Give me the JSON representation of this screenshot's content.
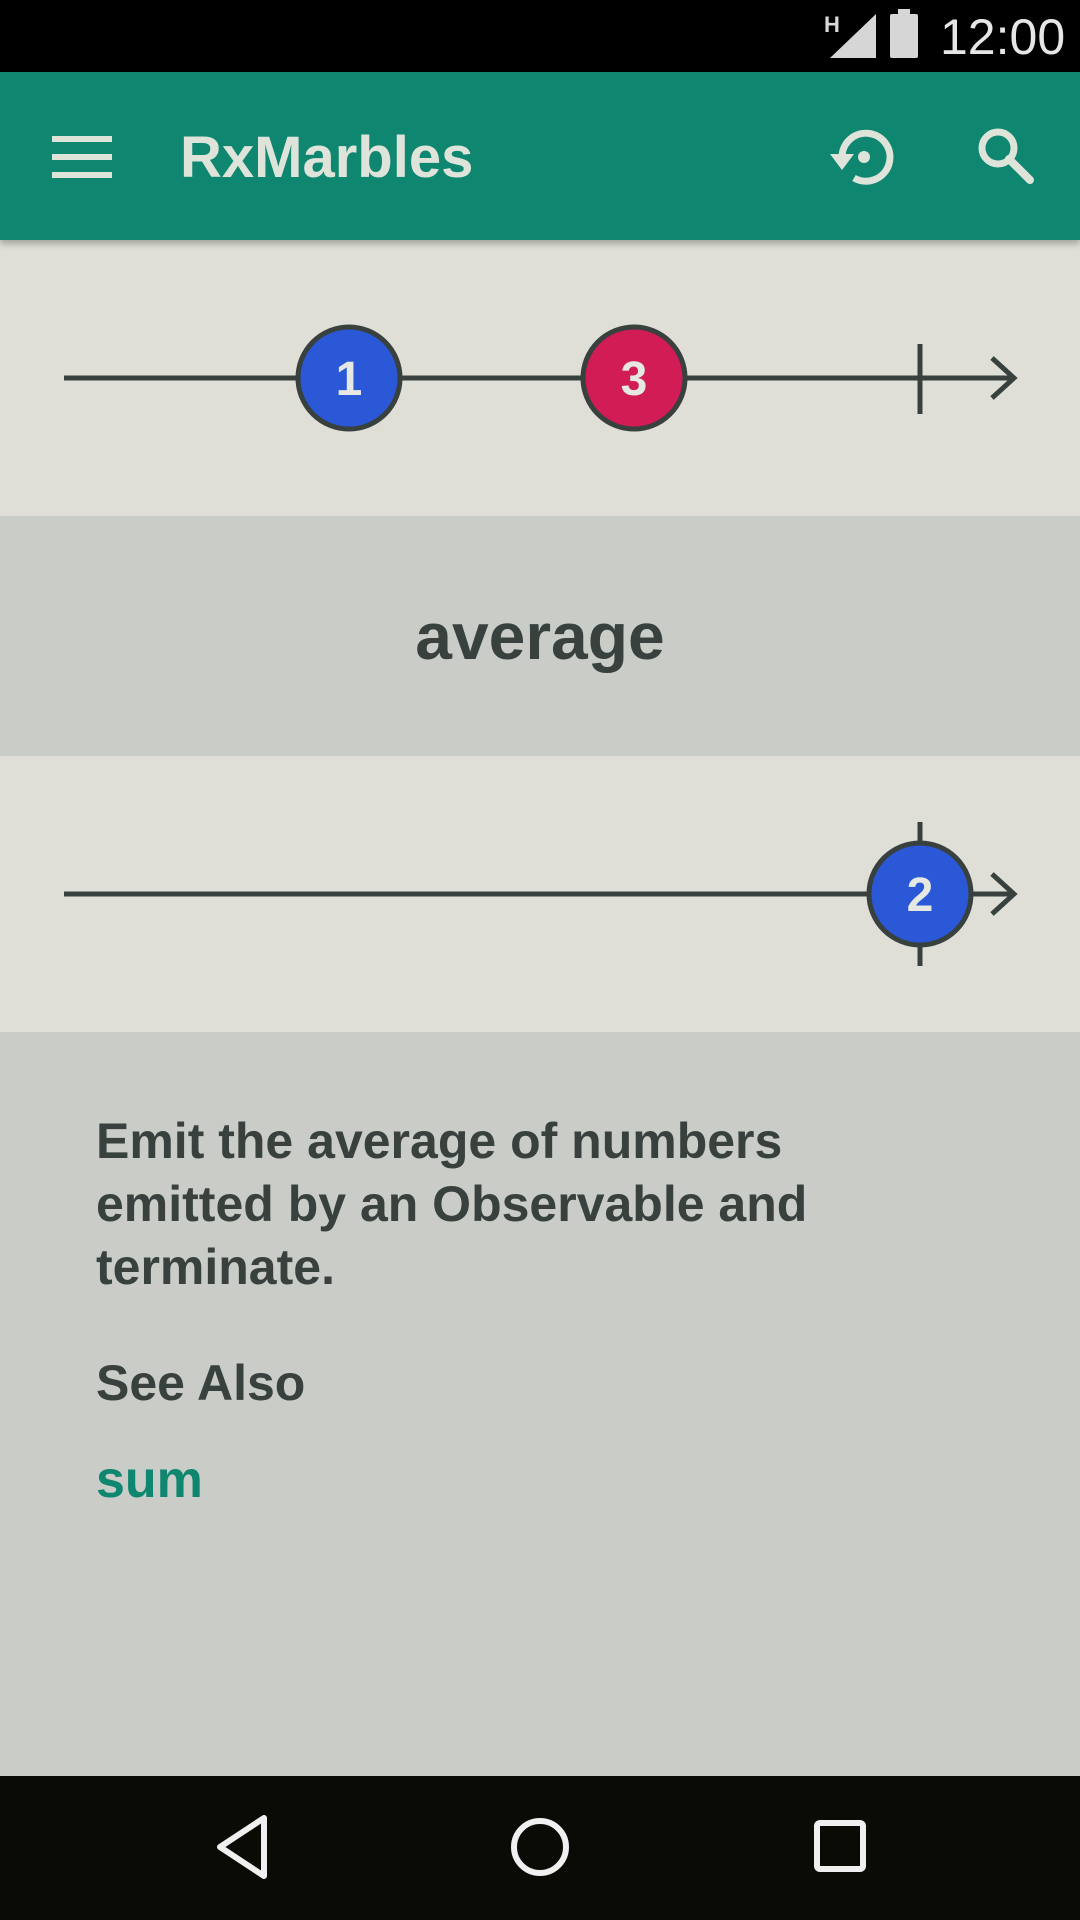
{
  "status_bar": {
    "network_type": "H",
    "time": "12:00",
    "icons": [
      "signal-icon",
      "battery-icon"
    ]
  },
  "app_bar": {
    "title": "RxMarbles",
    "icons": [
      "menu-icon",
      "restore-icon",
      "search-icon"
    ],
    "background_color": "#0e8670"
  },
  "input_stream": {
    "marbles": [
      {
        "label": "1",
        "color": "#2b58d6"
      },
      {
        "label": "3",
        "color": "#d11c56"
      }
    ],
    "completed": true
  },
  "operator": {
    "name": "average"
  },
  "output_stream": {
    "marbles": [
      {
        "label": "2",
        "color": "#2b58d6"
      }
    ],
    "completed": true
  },
  "description": {
    "text": "Emit the average of numbers emitted by an Observable and terminate.",
    "see_also_heading": "See Also",
    "see_also_links": [
      "sum"
    ]
  },
  "nav_bar": {
    "icons": [
      "back-icon",
      "home-icon",
      "recents-icon"
    ]
  }
}
